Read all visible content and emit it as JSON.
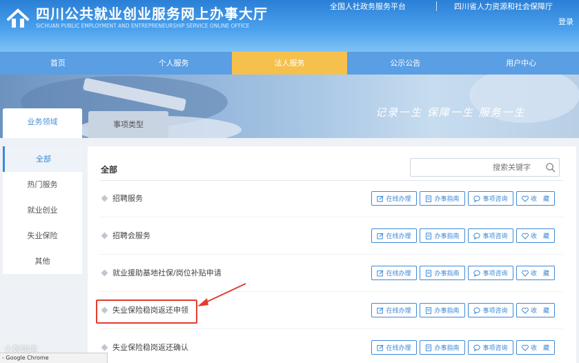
{
  "header": {
    "title": "四川公共就业创业服务网上办事大厅",
    "subtitle": "SICHUAN PUBLIC EMPLOYMENT AND ENTREPRENEURSHIP SERVICE ONLINE OFFICE",
    "top_links": [
      "全国人社政务服务平台",
      "四川省人力资源和社会保障厅"
    ],
    "login": "登录"
  },
  "nav": {
    "items": [
      {
        "label": "首页"
      },
      {
        "label": "个人服务"
      },
      {
        "label": "法人服务",
        "active": true
      },
      {
        "label": "公示公告"
      },
      {
        "label": "用户中心"
      }
    ]
  },
  "banner": {
    "slogan": "记录一生  保障一生  服务一生"
  },
  "tabs": [
    "业务领域",
    "事项类型"
  ],
  "sidebar": {
    "items": [
      {
        "label": "全部",
        "active": true
      },
      {
        "label": "热门服务"
      },
      {
        "label": "就业创业"
      },
      {
        "label": "失业保险"
      },
      {
        "label": "其他"
      }
    ]
  },
  "main": {
    "title": "全部",
    "search_placeholder": "搜索关键字",
    "buttons": {
      "online": "在线办理",
      "guide": "办事指南",
      "consult": "事项咨询",
      "favorite": "收　藏"
    },
    "rows": [
      {
        "label": "招聘服务"
      },
      {
        "label": "招聘会服务"
      },
      {
        "label": "就业援助基地社保/岗位补贴申请"
      },
      {
        "label": "失业保险稳岗返还申领"
      },
      {
        "label": "失业保险稳岗返还确认"
      }
    ]
  },
  "statusbar": "- Google Chrome",
  "watermark": "大数跨境",
  "colors": {
    "primary": "#3d89d6",
    "nav_active": "#f6c04c",
    "highlight": "#e23b2f"
  }
}
